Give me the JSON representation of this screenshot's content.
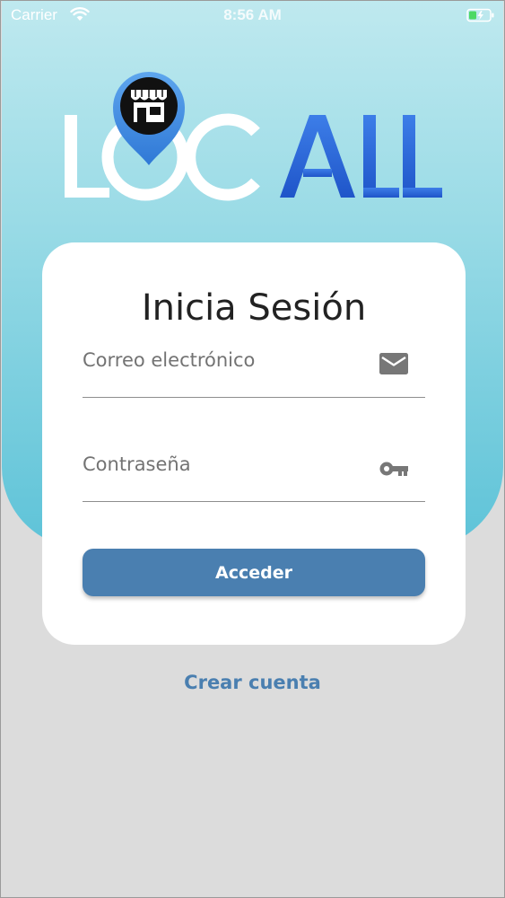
{
  "status_bar": {
    "carrier": "Carrier",
    "time": "8:56 AM"
  },
  "logo": {
    "text": "LOCALL",
    "icon": "store-pin-icon",
    "colors": {
      "lo_letters": "#ffffff",
      "call_letters": "#2463d6",
      "pin": "#4a8fdb",
      "store": "#111111"
    }
  },
  "login_card": {
    "title": "Inicia Sesión",
    "email_field": {
      "placeholder": "Correo electrónico",
      "value": "",
      "icon": "mail-icon"
    },
    "password_field": {
      "placeholder": "Contraseña",
      "value": "",
      "icon": "key-icon"
    },
    "submit_label": "Acceder"
  },
  "create_account_label": "Crear cuenta",
  "colors": {
    "accent": "#4a7fb0",
    "gradient_top": "#bfe9ef",
    "gradient_bottom": "#5ec3d8",
    "page_background": "#dcdcdc"
  }
}
